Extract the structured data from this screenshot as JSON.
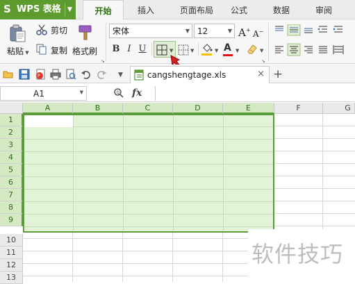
{
  "app": {
    "name": "WPS 表格",
    "logo": "S"
  },
  "menu_tabs": [
    "开始",
    "插入",
    "页面布局",
    "公式",
    "数据",
    "审阅"
  ],
  "ribbon": {
    "paste_label": "粘贴",
    "cut_label": "剪切",
    "copy_label": "复制",
    "format_painter_label": "格式刷",
    "font_name": "宋体",
    "font_size": "12",
    "bold": "B",
    "italic": "I",
    "underline": "U",
    "grow_font": "A",
    "shrink_font": "A",
    "font_color_letter": "A"
  },
  "quick_access_icons": [
    "folder-open-icon",
    "save-icon",
    "export-pdf-icon",
    "print-icon",
    "print-preview-icon",
    "undo-icon",
    "redo-icon"
  ],
  "document": {
    "tab_title": "cangshengtage.xls",
    "close": "×",
    "new_tab": "+"
  },
  "formula_bar": {
    "cell_ref": "A1",
    "fx_label": "fx",
    "value": ""
  },
  "grid": {
    "columns": [
      "A",
      "B",
      "C",
      "D",
      "E",
      "F",
      "G"
    ],
    "rows": [
      "1",
      "2",
      "3",
      "4",
      "5",
      "6",
      "7",
      "8",
      "9",
      "10",
      "11",
      "12",
      "13"
    ],
    "selected_range": "A1:E9"
  },
  "colors": {
    "accent": "#5d9b2e",
    "selection_fill": "#e3f3d8",
    "selection_border": "#5a9b3a",
    "pointer_arrow": "#d42020"
  },
  "watermark": "软件技巧"
}
